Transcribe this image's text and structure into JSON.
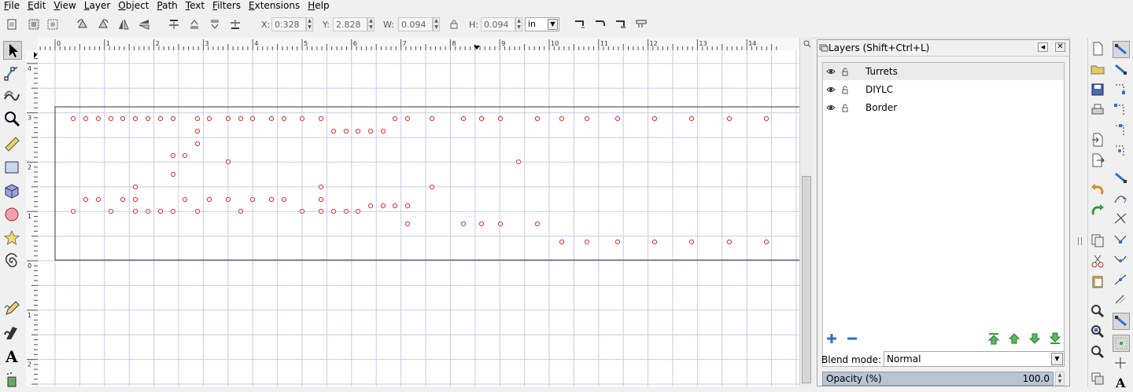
{
  "menu": [
    "File",
    "Edit",
    "View",
    "Layer",
    "Object",
    "Path",
    "Text",
    "Filters",
    "Extensions",
    "Help"
  ],
  "toolbar": {
    "x_label": "X:",
    "x_value": "0.328",
    "y_label": "Y:",
    "y_value": "2.828",
    "w_label": "W:",
    "w_value": "0.094",
    "h_label": "H:",
    "h_value": "0.094",
    "unit": "in"
  },
  "ruler": {
    "h_labels": [
      "0",
      "1",
      "2",
      "3",
      "4",
      "5",
      "6",
      "7",
      "8",
      "9",
      "10",
      "11",
      "12",
      "13",
      "14"
    ],
    "v_labels": [
      "4",
      "3",
      "2",
      "1",
      "0",
      "1",
      "2"
    ]
  },
  "layers": {
    "title": "Layers (Shift+Ctrl+L)",
    "items": [
      {
        "name": "Turrets",
        "selected": true
      },
      {
        "name": "DIYLC",
        "selected": false
      },
      {
        "name": "Border",
        "selected": false
      }
    ],
    "blend_label": "Blend mode:",
    "blend_value": "Normal",
    "opacity_label": "Opacity (%)",
    "opacity_value": "100.0"
  },
  "colors": {
    "turret": "#e03030",
    "grid": "#c8c8f0",
    "accent": "#2a6fd6"
  }
}
